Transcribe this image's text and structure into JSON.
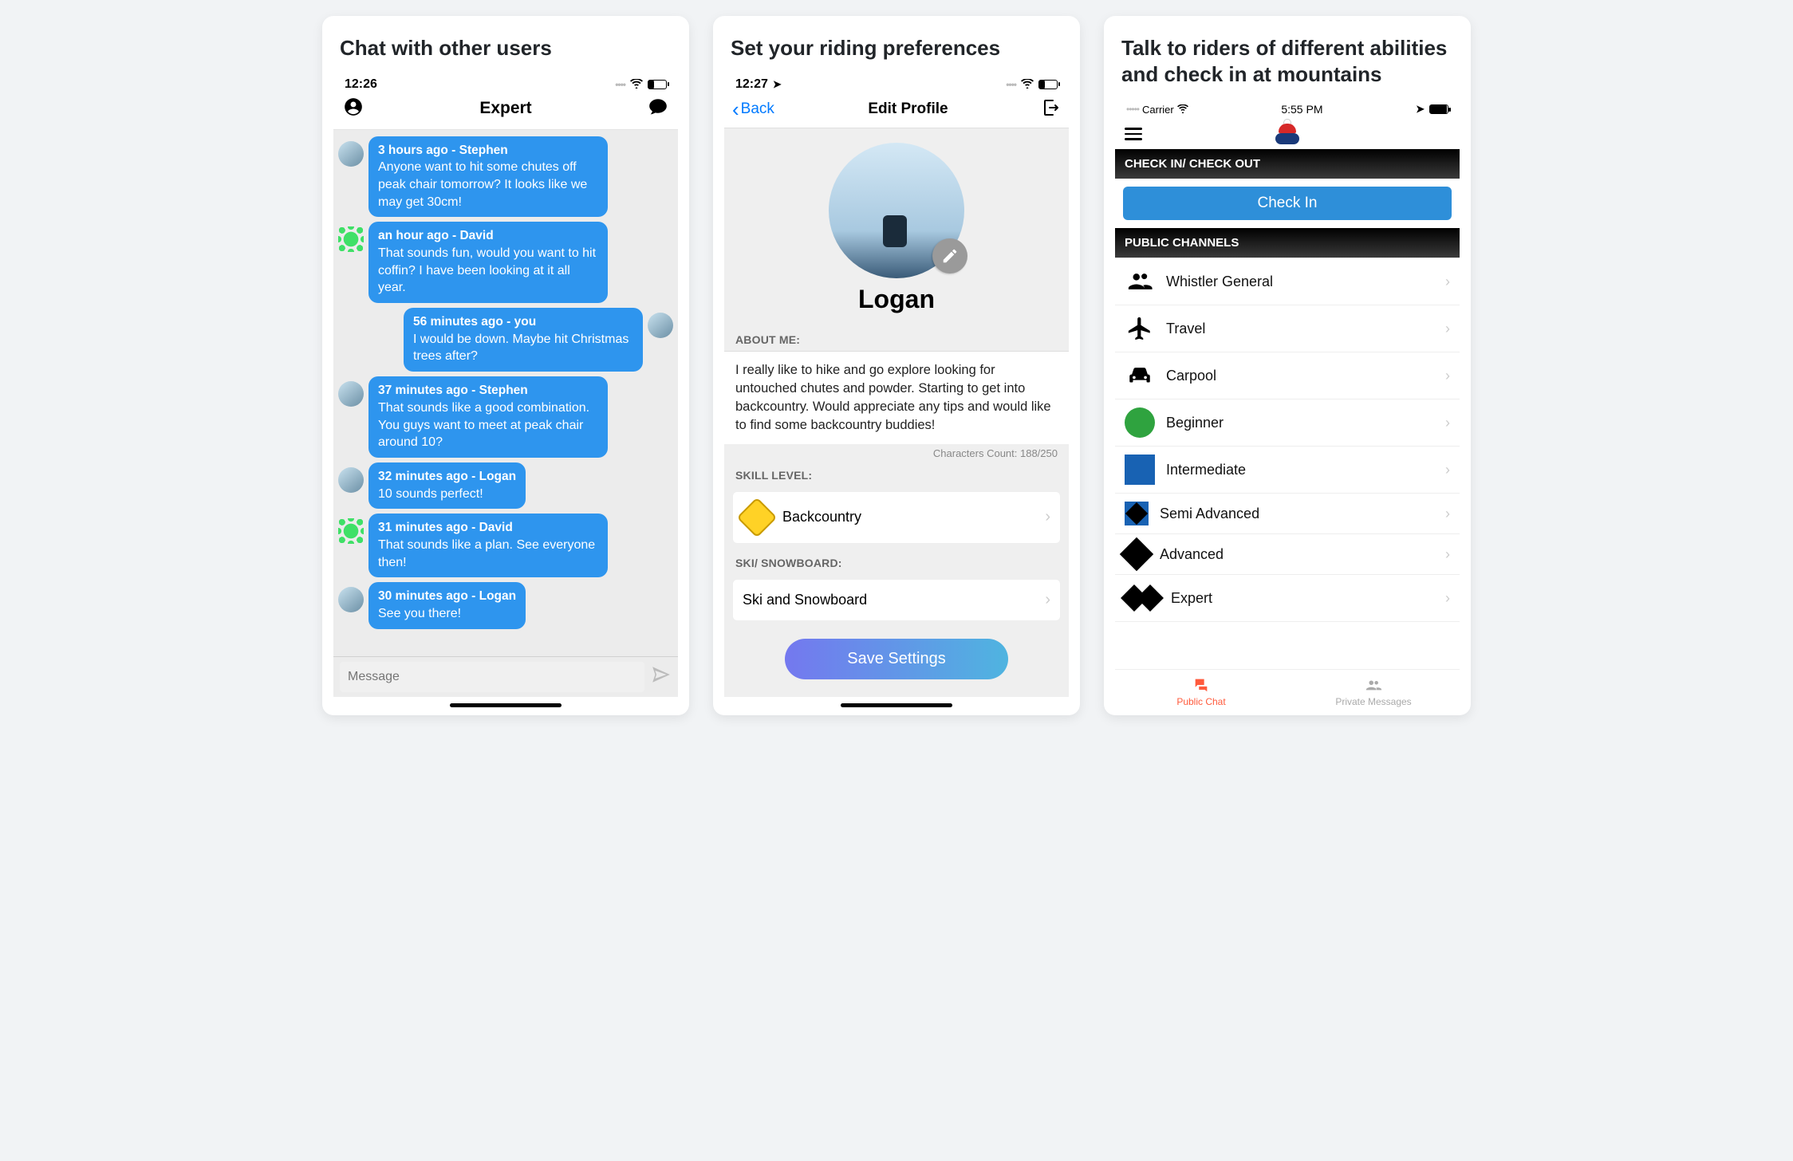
{
  "cards": {
    "chat": {
      "title": "Chat with other users",
      "status_time": "12:26",
      "room_name": "Expert",
      "messages": [
        {
          "meta": "3 hours ago - Stephen",
          "text": "Anyone want to hit some chutes off peak chair tomorrow?  It looks like we may get 30cm!",
          "side": "left",
          "avatar": "photo"
        },
        {
          "meta": "an hour ago - David",
          "text": "That sounds fun, would you want to hit coffin?  I have been looking at it all year.",
          "side": "left",
          "avatar": "green"
        },
        {
          "meta": "56 minutes ago - you",
          "text": "I would be down.  Maybe hit Christmas trees after?",
          "side": "right",
          "avatar": "photo"
        },
        {
          "meta": "37 minutes ago - Stephen",
          "text": "That sounds like a good combination.  You guys want to meet at peak chair around 10?",
          "side": "left",
          "avatar": "photo"
        },
        {
          "meta": "32 minutes ago - Logan",
          "text": "10 sounds perfect!",
          "side": "left",
          "avatar": "photo"
        },
        {
          "meta": "31 minutes ago - David",
          "text": "That sounds like a plan.  See everyone then!",
          "side": "left",
          "avatar": "green"
        },
        {
          "meta": "30 minutes ago - Logan",
          "text": "See you there!",
          "side": "left",
          "avatar": "photo"
        }
      ],
      "input_placeholder": "Message"
    },
    "profile": {
      "title": "Set your riding preferences",
      "status_time": "12:27",
      "back_label": "Back",
      "nav_title": "Edit Profile",
      "name": "Logan",
      "about_label": "ABOUT ME:",
      "about_text": "I really like to hike and go explore looking for untouched chutes and powder.  Starting to get into backcountry.  Would appreciate any tips and would like to find some backcountry buddies!",
      "char_count": "Characters Count: 188/250",
      "skill_label": "SKILL LEVEL:",
      "skill_value": "Backcountry",
      "discipline_label": "SKI/ SNOWBOARD:",
      "discipline_value": "Ski and Snowboard",
      "save_label": "Save Settings"
    },
    "channels": {
      "title": "Talk to riders of different abilities and check in at mountains",
      "carrier": "Carrier",
      "status_time": "5:55 PM",
      "checkin_header": "CHECK IN/ CHECK OUT",
      "checkin_button": "Check In",
      "public_header": "PUBLIC CHANNELS",
      "items": [
        {
          "icon": "people",
          "label": "Whistler General"
        },
        {
          "icon": "plane",
          "label": "Travel"
        },
        {
          "icon": "car",
          "label": "Carpool"
        },
        {
          "icon": "green-circ",
          "label": "Beginner"
        },
        {
          "icon": "blue-sq",
          "label": "Intermediate"
        },
        {
          "icon": "blue-diamond",
          "label": "Semi Advanced"
        },
        {
          "icon": "black-diamond",
          "label": "Advanced"
        },
        {
          "icon": "double-diamond",
          "label": "Expert"
        }
      ],
      "tab_public": "Public Chat",
      "tab_private": "Private Messages"
    }
  }
}
